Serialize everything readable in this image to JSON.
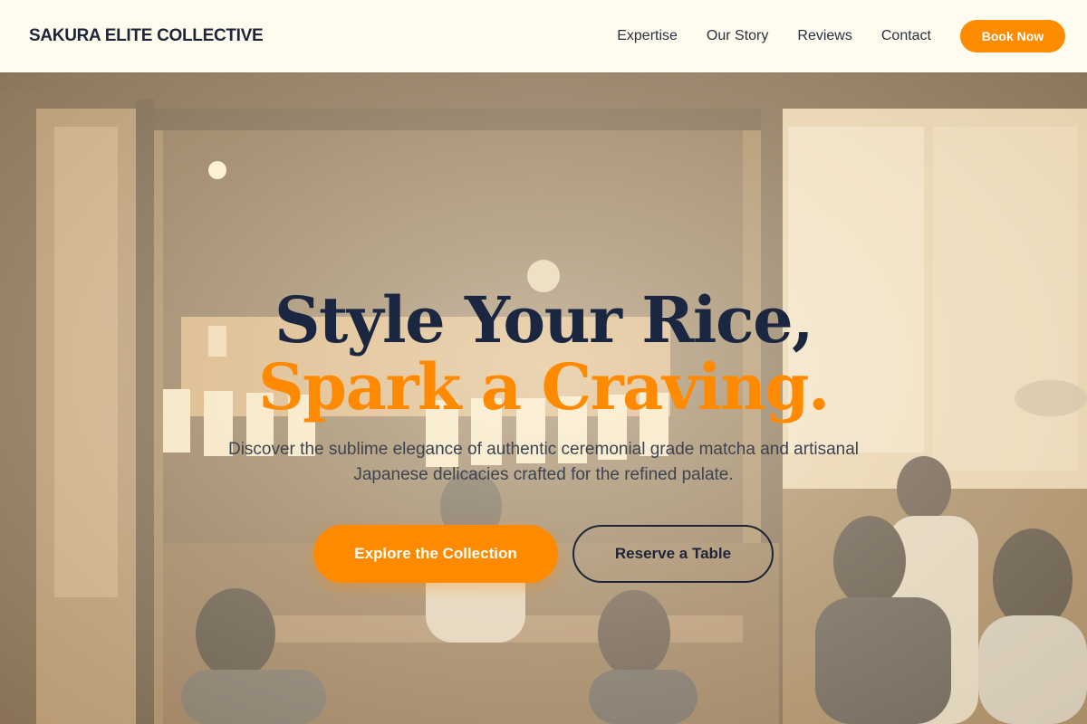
{
  "navbar": {
    "brand": "SAKURA ELITE COLLECTIVE",
    "links": [
      "Expertise",
      "Our Story",
      "Reviews",
      "Contact"
    ],
    "book_label": "Book Now"
  },
  "hero": {
    "headline_line1": "Style Your Rice,",
    "headline_line2": "Spark a Craving.",
    "subtitle": "Discover the sublime elegance of authentic ceremonial grade matcha and artisanal Japanese delicacies crafted for the refined palate.",
    "primary_cta": "Explore the Collection",
    "secondary_cta": "Reserve a Table",
    "background_image": "restaurant-interior-photo"
  },
  "colors": {
    "accent": "#ff8a00",
    "navy": "#1b2740",
    "cream": "#fffbee"
  }
}
